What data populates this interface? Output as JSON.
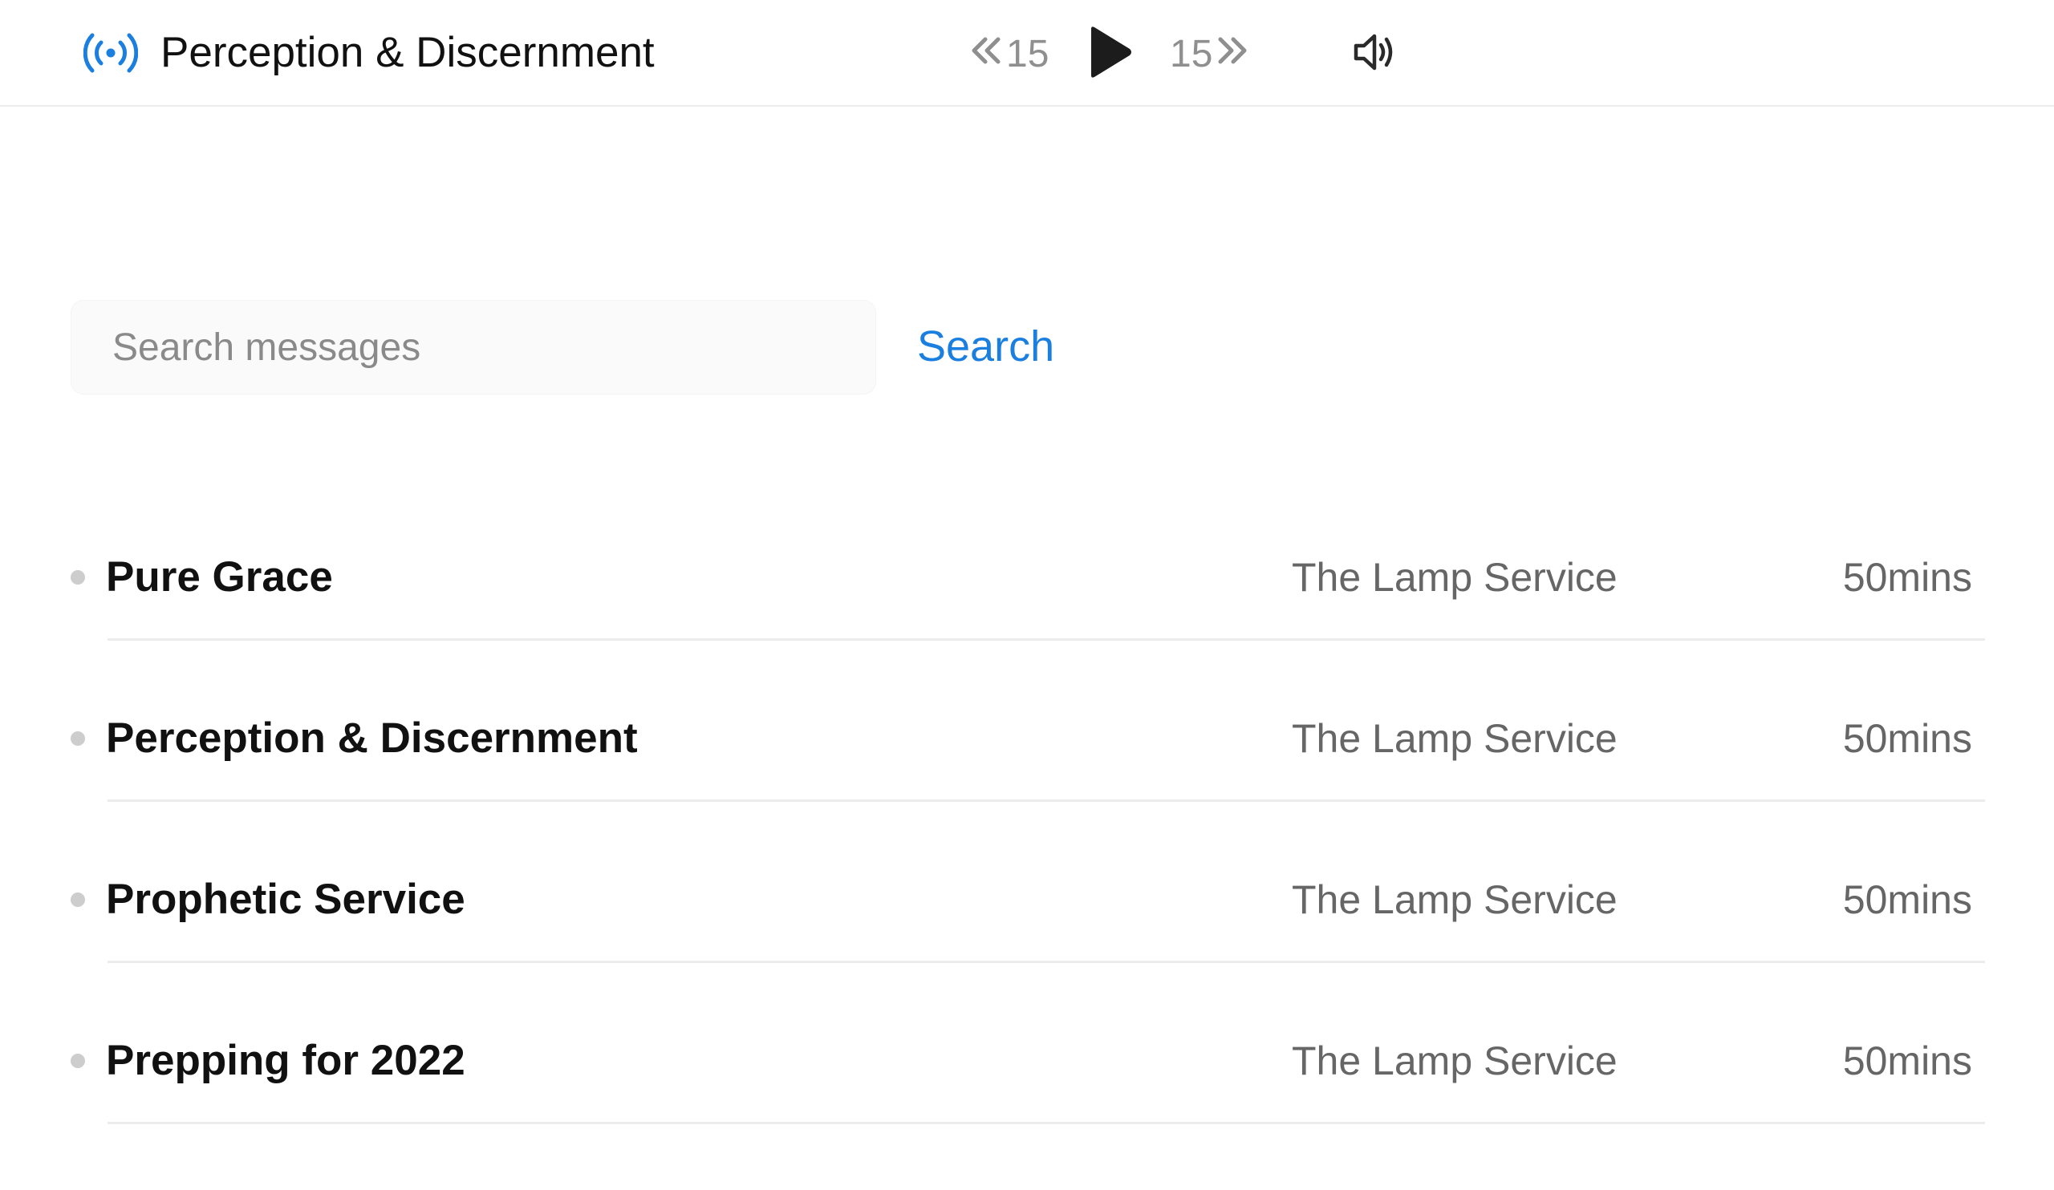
{
  "player": {
    "now_playing_title": "Perception & Discernment",
    "live_icon": "broadcast-icon",
    "skip_back_label": "15",
    "skip_forward_label": "15",
    "play_icon": "play-icon",
    "volume_icon": "volume-icon",
    "accent_color": "#1b7fe0"
  },
  "search": {
    "placeholder": "Search messages",
    "value": "",
    "button_label": "Search"
  },
  "messages": [
    {
      "title": "Pure Grace",
      "service": "The Lamp Service",
      "duration": "50mins"
    },
    {
      "title": "Perception & Discernment",
      "service": "The Lamp Service",
      "duration": "50mins"
    },
    {
      "title": "Prophetic Service",
      "service": "The Lamp Service",
      "duration": "50mins"
    },
    {
      "title": "Prepping for 2022",
      "service": "The Lamp Service",
      "duration": "50mins"
    }
  ]
}
